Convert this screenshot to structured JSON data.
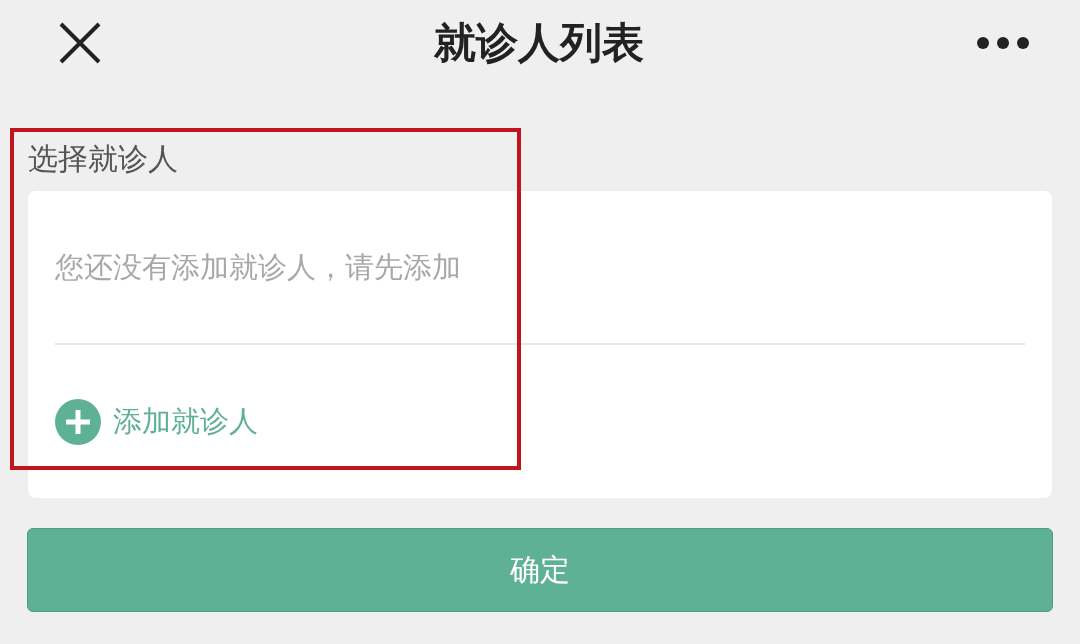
{
  "header": {
    "title": "就诊人列表"
  },
  "section_label": "选择就诊人",
  "patients_card": {
    "empty_message": "您还没有添加就诊人，请先添加",
    "add_link": "添加就诊人"
  },
  "confirm_button": "确定",
  "annotation": {
    "kind": "highlight-frame"
  }
}
